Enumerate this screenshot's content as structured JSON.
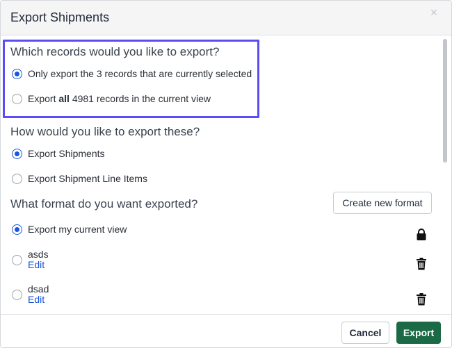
{
  "modal": {
    "title": "Export Shipments",
    "close_glyph": "×"
  },
  "records_section": {
    "title": "Which records would you like to export?",
    "options": [
      {
        "label": "Only export the 3 records that are currently selected",
        "selected": true
      },
      {
        "label_prefix": "Export ",
        "label_bold": "all",
        "label_suffix": " 4981 records in the current view",
        "selected": false
      }
    ]
  },
  "export_type_section": {
    "title": "How would you like to export these?",
    "options": [
      {
        "label": "Export Shipments",
        "selected": true
      },
      {
        "label": "Export Shipment Line Items",
        "selected": false
      }
    ]
  },
  "format_section": {
    "title": "What format do you want exported?",
    "create_button_label": "Create new format",
    "current_view_label": "Export my current view",
    "current_view_icon": "lock-icon",
    "formats": [
      {
        "name": "asds",
        "edit_label": "Edit",
        "icon": "trash-icon",
        "selected": false
      },
      {
        "name": "dsad",
        "edit_label": "Edit",
        "icon": "trash-icon",
        "selected": false
      }
    ]
  },
  "footer": {
    "cancel_label": "Cancel",
    "export_label": "Export"
  },
  "colors": {
    "accent_radio": "#1a56db",
    "highlight_border": "#5b4cf5",
    "export_button": "#1a6b45"
  }
}
